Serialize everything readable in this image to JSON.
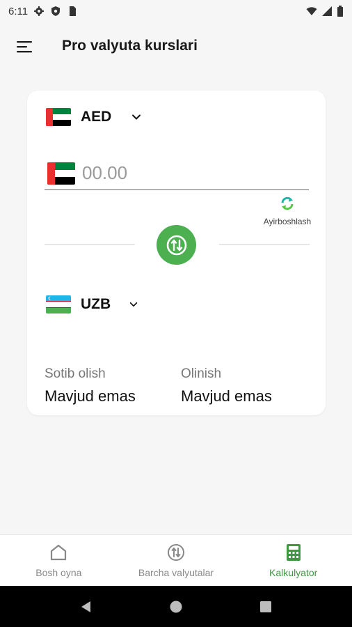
{
  "status_bar": {
    "time": "6:11",
    "icons": [
      "gear-icon",
      "shield-icon",
      "sim-icon",
      "wifi-icon",
      "signal-icon",
      "battery-icon"
    ]
  },
  "app_bar": {
    "title": "Pro valyuta kurslari",
    "menu_icon": "hamburger-menu-icon"
  },
  "converter": {
    "from_currency": {
      "code": "AED",
      "flag": "uae-flag"
    },
    "amount": {
      "value": "",
      "placeholder": "00.00"
    },
    "exchange_label": "Ayirboshlash",
    "to_currency": {
      "code": "UZB",
      "flag": "uzbekistan-flag"
    },
    "buy": {
      "label": "Sotib olish",
      "value": "Mavjud emas"
    },
    "sell": {
      "label": "Olinish",
      "value": "Mavjud emas"
    }
  },
  "bottom_nav": {
    "items": [
      {
        "label": "Bosh oyna",
        "icon": "home-icon",
        "active": false
      },
      {
        "label": "Barcha valyutalar",
        "icon": "currency-swap-icon",
        "active": false
      },
      {
        "label": "Kalkulyator",
        "icon": "calculator-icon",
        "active": true
      }
    ]
  },
  "colors": {
    "accent": "#4caf50",
    "accent_text": "#3d9a40",
    "background": "#f6f6f6",
    "card": "#ffffff"
  }
}
